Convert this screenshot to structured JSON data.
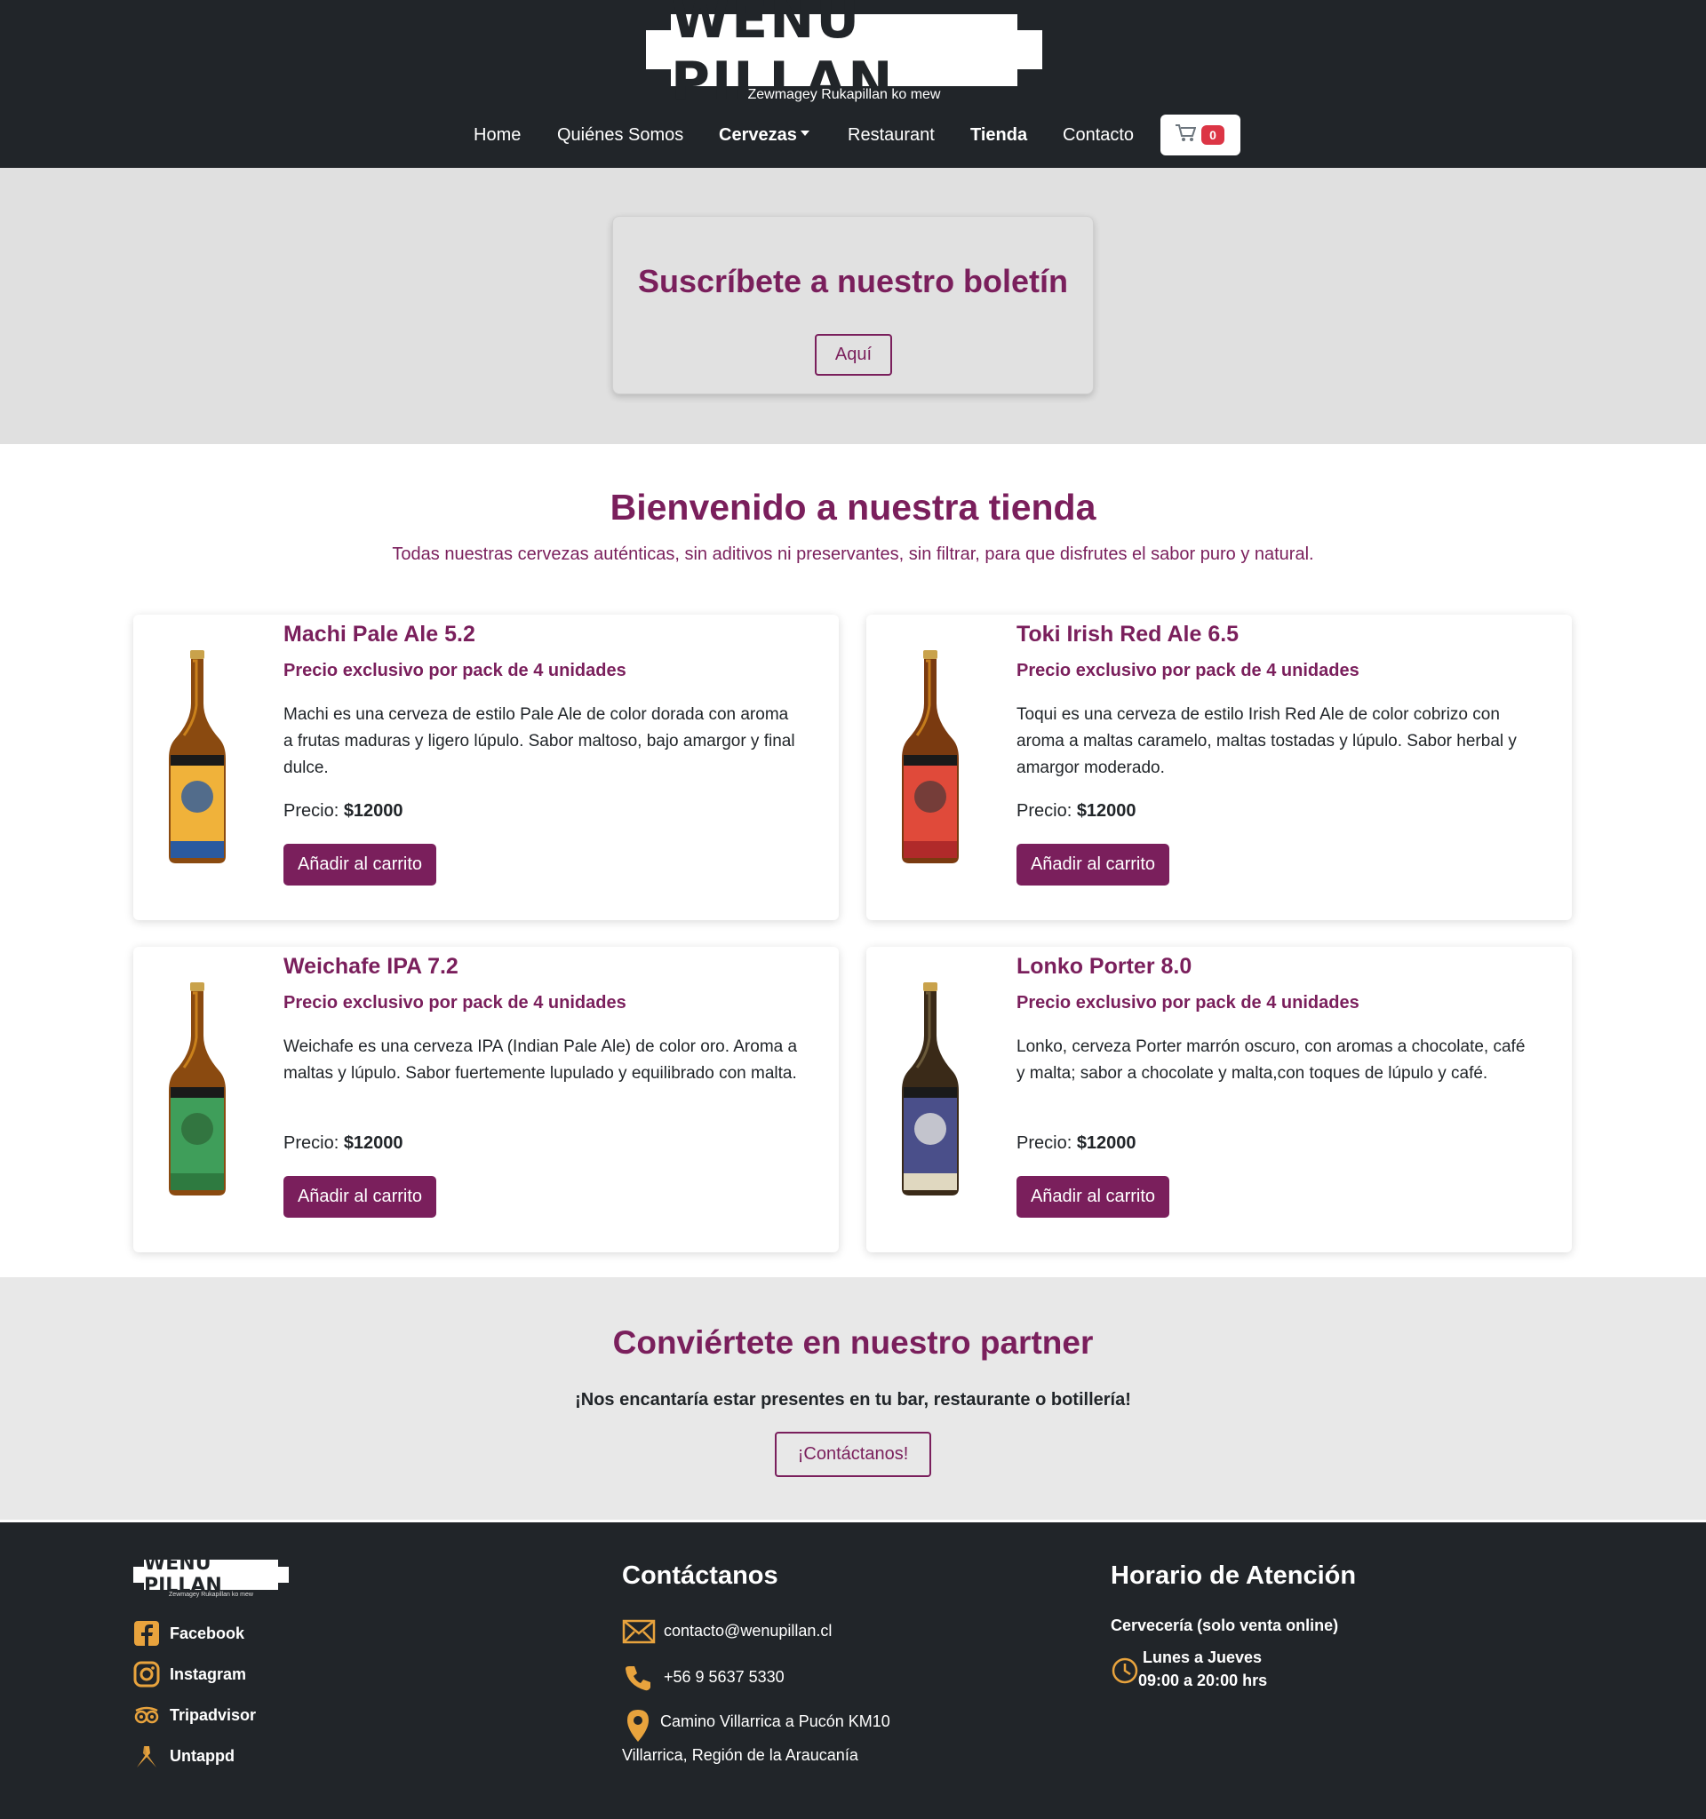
{
  "header": {
    "logo_text": "WENU PILLAN",
    "tagline": "Zewmagey Rukapillan ko mew",
    "nav": {
      "home": "Home",
      "quienes": "Quiénes Somos",
      "cervezas": "Cervezas",
      "restaurant": "Restaurant",
      "tienda": "Tienda",
      "contacto": "Contacto"
    },
    "cart_count": "0"
  },
  "newsletter": {
    "title": "Suscríbete a nuestro boletín",
    "button": "Aquí"
  },
  "store": {
    "title": "Bienvenido a nuestra tienda",
    "subtitle": "Todas nuestras cervezas auténticas, sin aditivos ni preservantes, sin filtrar, para que disfrutes el sabor puro y natural.",
    "price_label": "Precio:",
    "add_label": "Añadir al carrito",
    "products": [
      {
        "name": "Machi Pale Ale 5.2",
        "pack": "Precio exclusivo por pack de 4 unidades",
        "description": "Machi es una cerveza de estilo Pale Ale de color dorada con aroma a frutas maduras y ligero lúpulo. Sabor maltoso, bajo amargor y final dulce.",
        "price": "$12000",
        "label_color": "#f0b23a"
      },
      {
        "name": "Toki Irish Red Ale 6.5",
        "pack": "Precio exclusivo por pack de 4 unidades",
        "description": "Toqui es una cerveza de estilo Irish Red Ale de color cobrizo con aroma a maltas caramelo, maltas tostadas y lúpulo. Sabor herbal y amargor moderado.",
        "price": "$12000",
        "label_color": "#e04a3a"
      },
      {
        "name": "Weichafe IPA 7.2",
        "pack": "Precio exclusivo por pack de 4 unidades",
        "description": "Weichafe es una cerveza IPA (Indian Pale Ale) de color oro. Aroma a maltas y lúpulo. Sabor fuertemente lupulado y equilibrado con malta.",
        "price": "$12000",
        "label_color": "#3f9e5a"
      },
      {
        "name": "Lonko Porter 8.0",
        "pack": "Precio exclusivo por pack de 4 unidades",
        "description": "Lonko, cerveza Porter marrón oscuro, con aromas a chocolate, café y malta; sabor a chocolate y malta,con toques de lúpulo y café.",
        "price": "$12000",
        "label_color": "#4a4f8a"
      }
    ]
  },
  "partner": {
    "title": "Conviértete en nuestro partner",
    "subtitle": "¡Nos encantaría estar presentes en tu bar, restaurante o botillería!",
    "button": "¡Contáctanos!"
  },
  "footer": {
    "social": {
      "facebook": "Facebook",
      "instagram": "Instagram",
      "tripadvisor": "Tripadvisor",
      "untappd": "Untappd"
    },
    "contact": {
      "title": "Contáctanos",
      "email": "contacto@wenupillan.cl",
      "phone": "+56 9 5637 5330",
      "address_1": "Camino Villarrica a Pucón KM10",
      "address_2": "Villarrica, Región de la Araucanía"
    },
    "hours": {
      "title": "Horario de Atención",
      "subtitle": "Cervecería (solo venta online)",
      "days": "Lunes a Jueves",
      "time": "09:00 a 20:00 hrs"
    },
    "accent_color": "#e8a33d"
  },
  "colors": {
    "brand": "#7a1f5c",
    "dark": "#212529",
    "badge": "#dc3545"
  }
}
